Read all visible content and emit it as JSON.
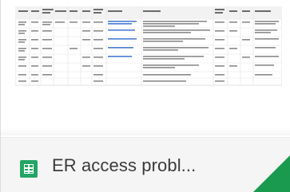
{
  "file_card": {
    "title": "ER access probl...",
    "file_type_icon": "google-sheets-icon",
    "accent_color": "#1a9a4f"
  }
}
